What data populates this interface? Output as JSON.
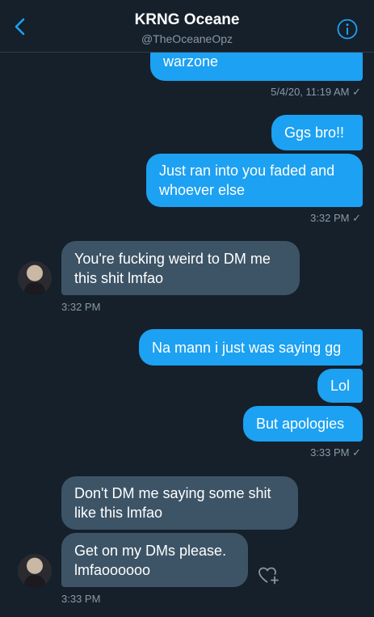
{
  "header": {
    "title": "KRNG Oceane",
    "handle": "@TheOceaneOpz"
  },
  "colors": {
    "background": "#15202b",
    "outgoing": "#1da1f2",
    "incoming": "#3d5466",
    "meta": "#8899a6"
  },
  "icons": {
    "back": "chevron-left-icon",
    "info": "info-icon",
    "react": "heart-plus-icon"
  },
  "messages": {
    "m1": "warzone",
    "t1": "5/4/20, 11:19 AM ✓",
    "m2": "Ggs bro!!",
    "m3": "Just ran into you faded and whoever else",
    "t2": "3:32 PM ✓",
    "m4": "You're fucking weird to DM me this shit lmfao",
    "t3": "3:32 PM",
    "m5": "Na mann i just was saying gg",
    "m6": "Lol",
    "m7": "But apologies",
    "t4": "3:33 PM ✓",
    "m8": "Don't DM me saying some shit like this lmfao",
    "m9": "Get on my DMs please. lmfaoooooo",
    "t5": "3:33 PM"
  }
}
